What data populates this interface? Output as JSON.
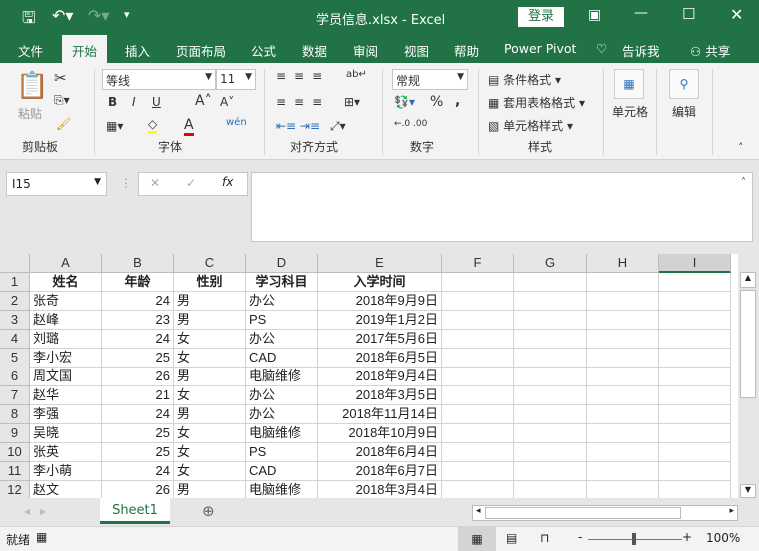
{
  "title": {
    "file": "学员信息.xlsx  -  Excel",
    "login": "登录"
  },
  "tabs": [
    "文件",
    "开始",
    "插入",
    "页面布局",
    "公式",
    "数据",
    "审阅",
    "视图",
    "帮助",
    "Power Pivot",
    "告诉我",
    "共享"
  ],
  "ribbon": {
    "paste": "粘贴",
    "clipboard": "剪贴板",
    "font_name": "等线",
    "font_size": "11",
    "font": "字体",
    "align": "对齐方式",
    "number_format": "常规",
    "number": "数字",
    "cond_format": "条件格式",
    "table_format": "套用表格格式",
    "cell_style": "单元格样式",
    "styles": "样式",
    "cells": "单元格",
    "edit": "编辑",
    "bold": "B",
    "italic": "I",
    "underline": "U",
    "percent": "%",
    "comma": ","
  },
  "formula": {
    "name_box": "I15",
    "fx": "fx",
    "value": ""
  },
  "columns": [
    "A",
    "B",
    "C",
    "D",
    "E",
    "F",
    "G",
    "H",
    "I"
  ],
  "rows": [
    [
      "姓名",
      "年龄",
      "性别",
      "学习科目",
      "入学时间"
    ],
    [
      "张奇",
      "24",
      "男",
      "办公",
      "2018年9月9日"
    ],
    [
      "赵峰",
      "23",
      "男",
      "PS",
      "2019年1月2日"
    ],
    [
      "刘璐",
      "24",
      "女",
      "办公",
      "2017年5月6日"
    ],
    [
      "李小宏",
      "25",
      "女",
      "CAD",
      "2018年6月5日"
    ],
    [
      "周文国",
      "26",
      "男",
      "电脑维修",
      "2018年9月4日"
    ],
    [
      "赵华",
      "21",
      "女",
      "办公",
      "2018年3月5日"
    ],
    [
      "李强",
      "24",
      "男",
      "办公",
      "2018年11月14日"
    ],
    [
      "吴晓",
      "25",
      "女",
      "电脑维修",
      "2018年10月9日"
    ],
    [
      "张英",
      "25",
      "女",
      "PS",
      "2018年6月4日"
    ],
    [
      "李小萌",
      "24",
      "女",
      "CAD",
      "2018年6月7日"
    ],
    [
      "赵文",
      "26",
      "男",
      "电脑维修",
      "2018年3月4日"
    ]
  ],
  "sheet": {
    "name": "Sheet1"
  },
  "status": {
    "ready": "就绪",
    "zoom": "100%"
  },
  "colors": {
    "accent": "#217346"
  }
}
